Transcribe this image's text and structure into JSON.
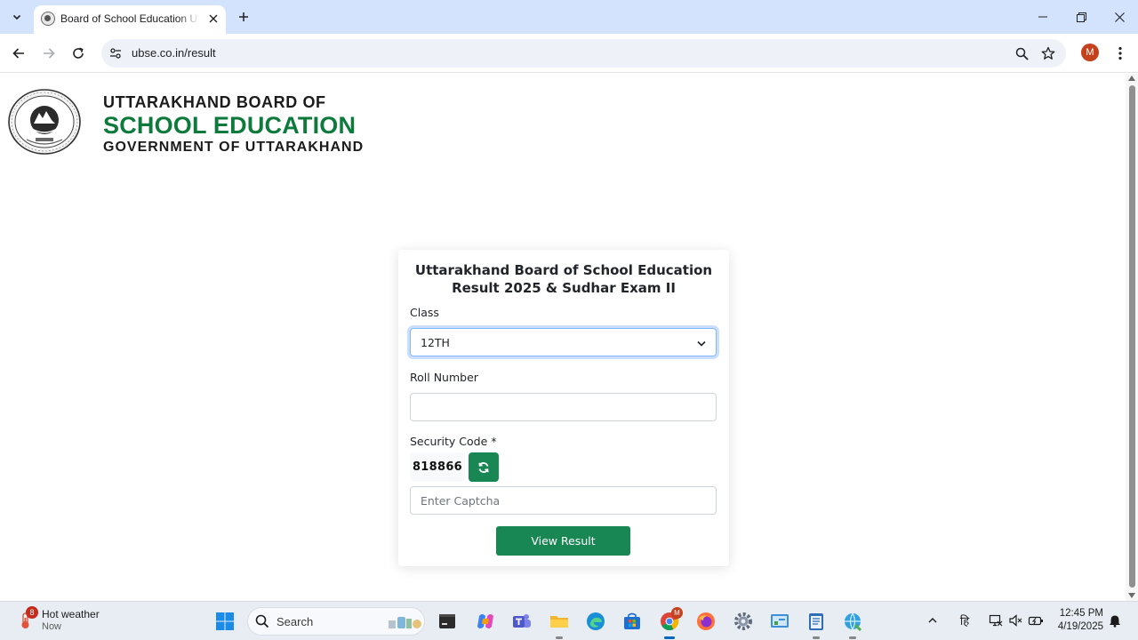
{
  "browser": {
    "tab_title": "Board of School Education Uttarakhand",
    "url": "ubse.co.in/result",
    "profile_initial": "M"
  },
  "header": {
    "line1": "UTTARAKHAND BOARD OF",
    "line2": "SCHOOL EDUCATION",
    "line3": "GOVERNMENT OF UTTARAKHAND"
  },
  "form": {
    "title_line1": "Uttarakhand Board of School Education",
    "title_line2": "Result 2025 & Sudhar Exam II",
    "class_label": "Class",
    "class_value": "12TH",
    "roll_label": "Roll Number",
    "roll_value": "",
    "security_label": "Security Code *",
    "captcha_code": "818866",
    "captcha_placeholder": "Enter Captcha",
    "submit_label": "View Result"
  },
  "taskbar": {
    "weather_title": "Hot weather",
    "weather_sub": "Now",
    "weather_badge": "8",
    "search_label": "Search",
    "chrome_badge": "M",
    "time": "12:45 PM",
    "date": "4/19/2025",
    "lang_glyph": "हि"
  },
  "colors": {
    "brand_green": "#0d7a3c",
    "button_green": "#198754",
    "tabstrip": "#d3e3fd"
  }
}
